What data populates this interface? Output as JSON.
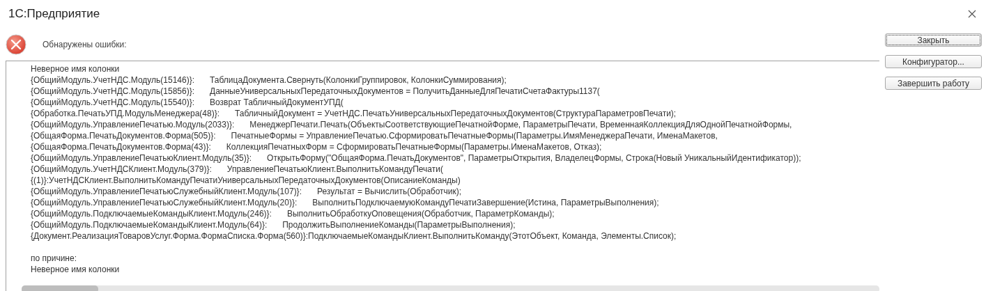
{
  "window": {
    "title": "1С:Предприятие"
  },
  "message": "Обнаружены ошибки:",
  "details": {
    "header": "Неверное имя колонки",
    "stack": [
      {
        "location": "{ОбщийМодуль.УчетНДС.Модуль(15146)}:",
        "code": "ТаблицаДокумента.Свернуть(КолонкиГруппировок, КолонкиСуммирования);"
      },
      {
        "location": "{ОбщийМодуль.УчетНДС.Модуль(15856)}:",
        "code": "ДанныеУниверсальныхПередаточныхДокументов = ПолучитьДанныеДляПечатиСчетаФактуры1137("
      },
      {
        "location": "{ОбщийМодуль.УчетНДС.Модуль(15540)}:",
        "code": "Возврат ТабличныйДокументУПД("
      },
      {
        "location": "{Обработка.ПечатьУПД.МодульМенеджера(48)}:",
        "code": "ТабличныйДокумент = УчетНДС.ПечатьУниверсальныхПередаточныхДокументов(СтруктураПараметровПечати);"
      },
      {
        "location": "{ОбщийМодуль.УправлениеПечатью.Модуль(2033)}:",
        "code": "МенеджерПечати.Печать(ОбъектыСоответствующиеПечатнойФорме, ПараметрыПечати, ВременнаяКоллекцияДляОднойПечатнойФормы,"
      },
      {
        "location": "{ОбщаяФорма.ПечатьДокументов.Форма(505)}:",
        "code": "ПечатныеФормы = УправлениеПечатью.СформироватьПечатныеФормы(Параметры.ИмяМенеджераПечати, ИменаМакетов,"
      },
      {
        "location": "{ОбщаяФорма.ПечатьДокументов.Форма(43)}:",
        "code": "КоллекцияПечатныхФорм = СформироватьПечатныеФормы(Параметры.ИменаМакетов, Отказ);"
      },
      {
        "location": "{ОбщийМодуль.УправлениеПечатьюКлиент.Модуль(35)}:",
        "code": "ОткрытьФорму(\"ОбщаяФорма.ПечатьДокументов\", ПараметрыОткрытия, ВладелецФормы, Строка(Новый УникальныйИдентификатор));"
      },
      {
        "location": "{ОбщийМодуль.УчетНДСКлиент.Модуль(379)}:",
        "code": "УправлениеПечатьюКлиент.ВыполнитьКомандуПечати("
      },
      {
        "location": "{(1)}:УчетНДСКлиент.ВыполнитьКомандуПечатиУниверсальныхПередаточныхДокументов(ОписаниеКоманды)"
      },
      {
        "location": "{ОбщийМодуль.УправлениеПечатьюСлужебныйКлиент.Модуль(107)}:",
        "code": "Результат = Вычислить(Обработчик);"
      },
      {
        "location": "{ОбщийМодуль.УправлениеПечатьюСлужебныйКлиент.Модуль(20)}:",
        "code": "ВыполнитьПодключаемуюКомандуПечатиЗавершение(Истина, ПараметрыВыполнения);"
      },
      {
        "location": "{ОбщийМодуль.ПодключаемыеКомандыКлиент.Модуль(246)}:",
        "code": "ВыполнитьОбработкуОповещения(Обработчик, ПараметрКоманды);"
      },
      {
        "location": "{ОбщийМодуль.ПодключаемыеКомандыКлиент.Модуль(64)}:",
        "code": "ПродолжитьВыполнениеКоманды(ПараметрыВыполнения);"
      },
      {
        "location": "{Документ.РеализацияТоваровУслуг.Форма.ФормаСписка.Форма(560)}:ПодключаемыеКомандыКлиент.ВыполнитьКоманду(ЭтотОбъект, Команда, Элементы.Список);"
      }
    ],
    "reason_label": "по причине:",
    "reason": "Неверное имя колонки"
  },
  "buttons": [
    {
      "label": "Закрыть",
      "focused": true
    },
    {
      "label": "Конфигуратор...",
      "focused": false
    },
    {
      "label": "Завершить работу",
      "focused": false
    }
  ]
}
